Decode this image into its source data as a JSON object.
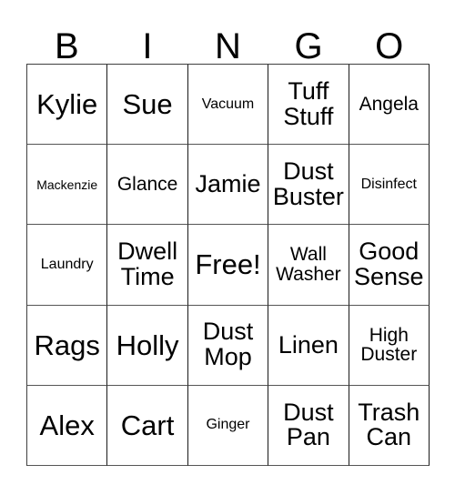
{
  "card": {
    "header_letters": [
      "B",
      "I",
      "N",
      "G",
      "O"
    ],
    "rows": [
      [
        {
          "text": "Kylie",
          "size": "lg",
          "lines": 1
        },
        {
          "text": "Sue",
          "size": "lg",
          "lines": 1
        },
        {
          "text": "Vacuum",
          "size": "xs",
          "lines": 1
        },
        {
          "text": "Tuff\nStuff",
          "size": "md",
          "lines": 2
        },
        {
          "text": "Angela",
          "size": "sm",
          "lines": 1
        }
      ],
      [
        {
          "text": "Mackenzie",
          "size": "xxs",
          "lines": 1
        },
        {
          "text": "Glance",
          "size": "sm",
          "lines": 1
        },
        {
          "text": "Jamie",
          "size": "md",
          "lines": 1
        },
        {
          "text": "Dust\nBuster",
          "size": "md",
          "lines": 2
        },
        {
          "text": "Disinfect",
          "size": "xs",
          "lines": 1
        }
      ],
      [
        {
          "text": "Laundry",
          "size": "xs",
          "lines": 1
        },
        {
          "text": "Dwell\nTime",
          "size": "md",
          "lines": 2
        },
        {
          "text": "Free!",
          "size": "lg",
          "lines": 1
        },
        {
          "text": "Wall\nWasher",
          "size": "sm",
          "lines": 2
        },
        {
          "text": "Good\nSense",
          "size": "md",
          "lines": 2
        }
      ],
      [
        {
          "text": "Rags",
          "size": "lg",
          "lines": 1
        },
        {
          "text": "Holly",
          "size": "lg",
          "lines": 1
        },
        {
          "text": "Dust\nMop",
          "size": "md",
          "lines": 2
        },
        {
          "text": "Linen",
          "size": "md",
          "lines": 1
        },
        {
          "text": "High\nDuster",
          "size": "sm",
          "lines": 2
        }
      ],
      [
        {
          "text": "Alex",
          "size": "lg",
          "lines": 1
        },
        {
          "text": "Cart",
          "size": "lg",
          "lines": 1
        },
        {
          "text": "Ginger",
          "size": "xs",
          "lines": 1
        },
        {
          "text": "Dust\nPan",
          "size": "md",
          "lines": 2
        },
        {
          "text": "Trash\nCan",
          "size": "md",
          "lines": 2
        }
      ]
    ],
    "free_space": {
      "row": 2,
      "col": 2,
      "label": "Free!"
    },
    "colors": {
      "background": "#ffffff",
      "text": "#000000",
      "grid_line": "#404040"
    }
  }
}
